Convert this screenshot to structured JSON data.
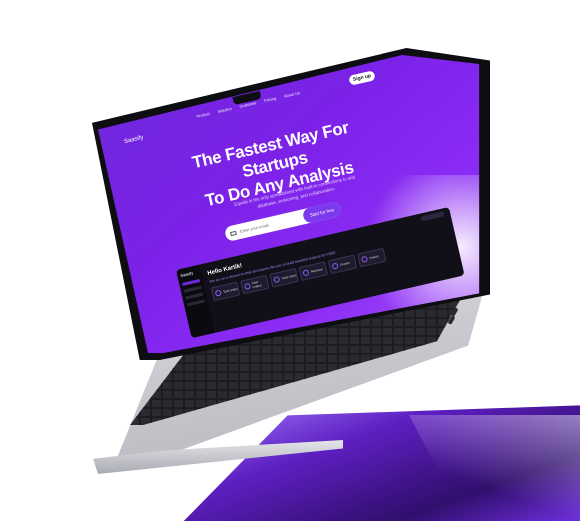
{
  "site": {
    "logo": "Saasify",
    "nav": [
      "Product",
      "Solution",
      "Customer",
      "Pricing",
      "About Us"
    ],
    "signup_label": "Sign up",
    "headline_line1": "The Fastest Way For Startups",
    "headline_line2": "To Do Any Analysis",
    "subtext": "Equals is the only spreadsheet with built-in connections to any database, versioning, and collaboration.",
    "email_placeholder": "Enter your email",
    "cta_label": "Start for free"
  },
  "dashboard": {
    "brand": "Saasify",
    "greeting": "Hello Kartik!",
    "subtitle": "We are on a mission to help developers like you to build beautiful projects for FREE.",
    "cards": [
      "Total Sales",
      "Total Orders",
      "Total Users",
      "Revenue",
      "Growth",
      "Visitors"
    ]
  },
  "colors": {
    "accent": "#7c3aed",
    "screen_bg": "#7c22e8",
    "pedestal": "#5b21b6"
  }
}
